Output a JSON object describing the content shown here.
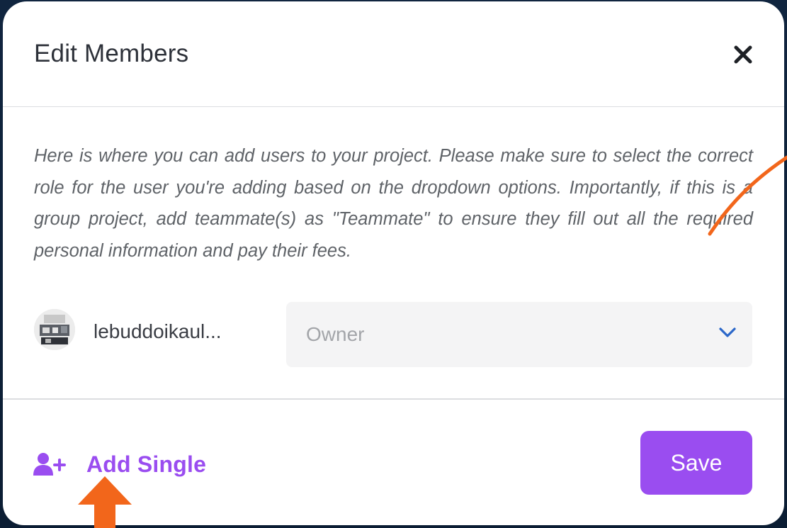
{
  "modal": {
    "title": "Edit Members",
    "close_icon": "close-icon",
    "description": "Here is where you can add users to your project. Please make sure to select the correct role for the user you're adding based on the dropdown options. Importantly, if this is a group project, add teammate(s) as \"Teammate\" to ensure they fill out all the required personal information and pay their fees."
  },
  "member": {
    "name": "lebuddoikaul...",
    "role": "Owner",
    "dropdown_icon": "chevron-down-icon"
  },
  "footer": {
    "add_single_label": "Add Single",
    "add_single_icon": "user-plus-icon",
    "save_label": "Save"
  },
  "colors": {
    "accent": "#9a4df0",
    "annotation": "#f2661b",
    "chevron": "#2b67c9"
  }
}
